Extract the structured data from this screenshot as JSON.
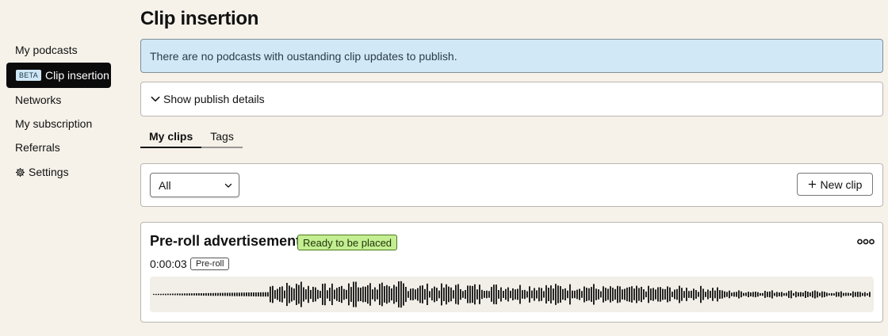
{
  "sidebar": {
    "items": [
      {
        "label": "My podcasts",
        "active": false
      },
      {
        "label": "Clip insertion",
        "badge": "BETA",
        "active": true
      },
      {
        "label": "Networks",
        "active": false
      },
      {
        "label": "My subscription",
        "active": false
      },
      {
        "label": "Referrals",
        "active": false
      },
      {
        "label": "Settings",
        "icon": "gear-icon",
        "active": false
      }
    ]
  },
  "page": {
    "title": "Clip insertion",
    "banner_text": "There are no podcasts with oustanding clip updates to publish.",
    "details_toggle_label": "Show publish details"
  },
  "tabs": [
    {
      "label": "My clips",
      "active": true
    },
    {
      "label": "Tags",
      "active": false
    }
  ],
  "toolbar": {
    "filter_selected": "All",
    "new_clip_label": "New clip"
  },
  "clip": {
    "title": "Pre-roll advertisement",
    "status": "Ready to be placed",
    "duration": "0:00:03",
    "tag": "Pre-roll"
  },
  "colors": {
    "background": "#f6f2ea",
    "banner": "#d1e9f7",
    "status_badge": "#c4ee92",
    "active_nav": "#0b0b0b",
    "beta_badge": "#cfe6f5"
  }
}
